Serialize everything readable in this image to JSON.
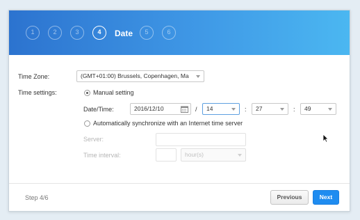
{
  "wizard": {
    "steps": [
      "1",
      "2",
      "3",
      "4",
      "5",
      "6"
    ],
    "current_step_title": "Date"
  },
  "form": {
    "timezone": {
      "label": "Time Zone:",
      "value": "(GMT+01:00) Brussels, Copenhagen, Ma"
    },
    "time_settings": {
      "label": "Time settings:",
      "manual_label": "Manual setting",
      "datetime_label": "Date/Time:",
      "date_value": "2016/12/10",
      "separator_slash": "/",
      "separator_colon": ":",
      "hour": "14",
      "minute": "27",
      "second": "49",
      "auto_sync_label": "Automatically synchronize with an Internet time server",
      "server_label": "Server:",
      "server_value": "",
      "interval_label": "Time interval:",
      "interval_value": "",
      "interval_unit": "hour(s)"
    }
  },
  "footer": {
    "step_text": "Step 4/6",
    "previous_label": "Previous",
    "next_label": "Next"
  },
  "colors": {
    "banner_start": "#2c73cf",
    "banner_end": "#4bb7f1",
    "primary_button": "#1f8cf0"
  }
}
